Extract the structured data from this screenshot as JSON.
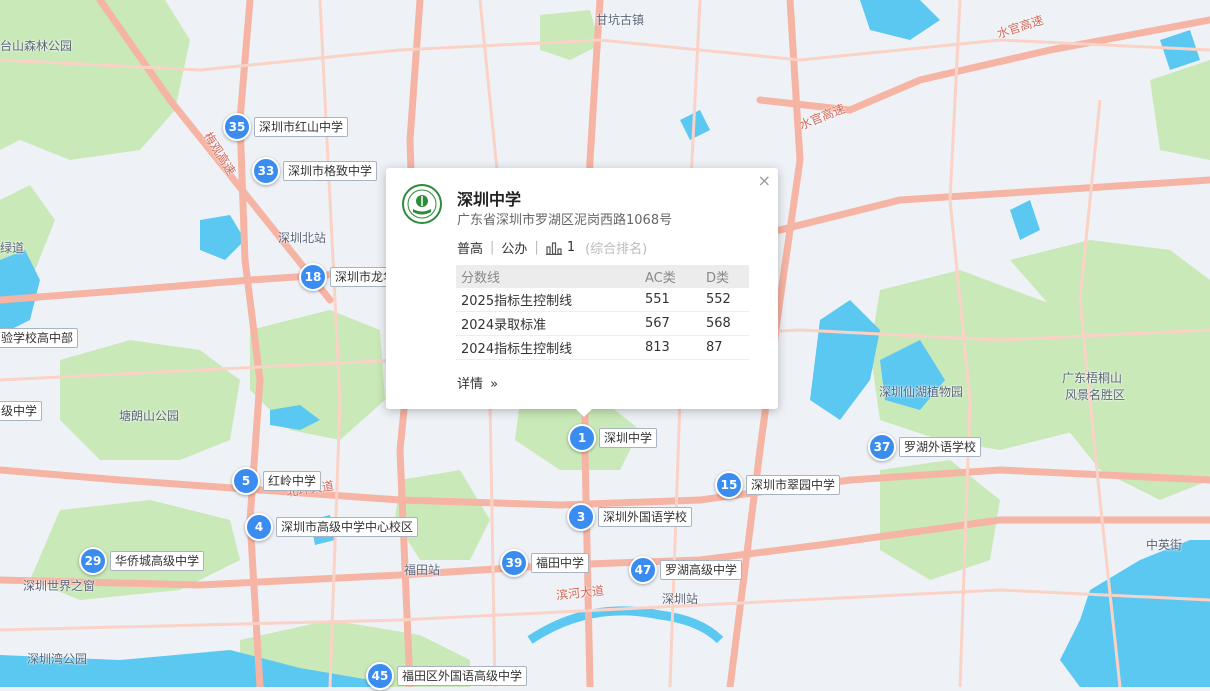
{
  "map": {
    "place_labels": [
      "甘坑古镇",
      "台山森林公园",
      "深圳北站",
      "绿道",
      "塘朗山公园",
      "深圳世界之窗",
      "深圳湾公园",
      "福田站",
      "深圳站",
      "深圳仙湖植物园",
      "广东梧桐山",
      "风景名胜区",
      "中英街"
    ],
    "road_labels": [
      "水官高速",
      "水官高速",
      "梅观高速",
      "北环大道",
      "滨河大道"
    ],
    "edge_labels": [
      "验学校高中部",
      "级中学"
    ]
  },
  "markers": [
    {
      "number": "35",
      "name": "深圳市红山中学"
    },
    {
      "number": "33",
      "name": "深圳市格致中学"
    },
    {
      "number": "18",
      "name": "深圳市龙华"
    },
    {
      "number": "5",
      "name": "红岭中学"
    },
    {
      "number": "4",
      "name": "深圳市高级中学中心校区"
    },
    {
      "number": "29",
      "name": "华侨城高级中学"
    },
    {
      "number": "1",
      "name": "深圳中学"
    },
    {
      "number": "3",
      "name": "深圳外国语学校"
    },
    {
      "number": "39",
      "name": "福田中学"
    },
    {
      "number": "47",
      "name": "罗湖高级中学"
    },
    {
      "number": "15",
      "name": "深圳市翠园中学"
    },
    {
      "number": "37",
      "name": "罗湖外语学校"
    },
    {
      "number": "45",
      "name": "福田区外国语高级中学"
    }
  ],
  "popup": {
    "close_symbol": "×",
    "title": "深圳中学",
    "address": "广东省深圳市罗湖区泥岗西路1068号",
    "tag1": "普高",
    "tag2": "公办",
    "rank": "1",
    "rank_note": "(综合排名)",
    "table": {
      "headers": [
        "分数线",
        "AC类",
        "D类"
      ],
      "rows": [
        [
          "2025指标生控制线",
          "551",
          "552"
        ],
        [
          "2024录取标准",
          "567",
          "568"
        ],
        [
          "2024指标生控制线",
          "813",
          "87"
        ]
      ]
    },
    "detail_label": "详情",
    "detail_icon": "double-chevron-right-icon"
  },
  "colors": {
    "water": "#5bc8f2",
    "green": "#c9e9b8",
    "road_major": "#f6b4a4",
    "marker": "#3b8cf0"
  }
}
